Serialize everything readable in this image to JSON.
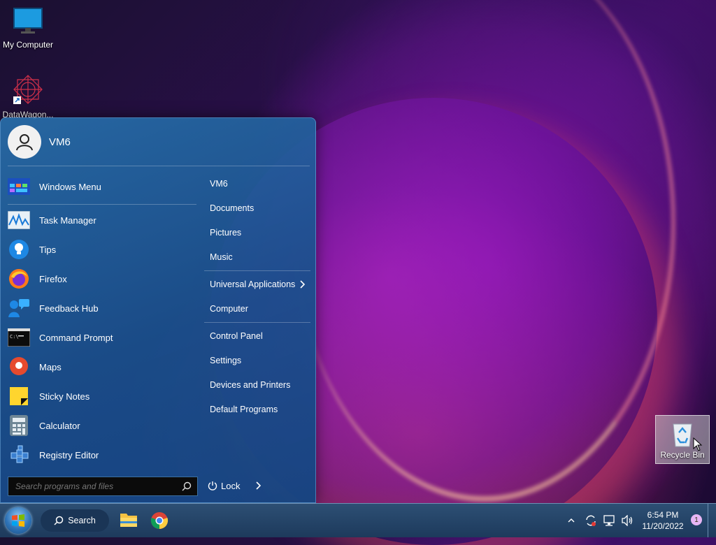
{
  "desktop": {
    "icons": [
      {
        "label": "My Computer",
        "icon": "monitor-icon"
      },
      {
        "label": "DataWagon...",
        "icon": "datawagon-shortcut-icon"
      }
    ],
    "recycle_bin": {
      "label": "Recycle Bin",
      "icon": "recycle-bin-icon"
    }
  },
  "start_menu": {
    "user": {
      "name": "VM6",
      "icon": "user-avatar-icon"
    },
    "pinned": [
      {
        "label": "Windows Menu",
        "icon": "windows-menu-icon"
      }
    ],
    "programs": [
      {
        "label": "Task Manager",
        "icon": "task-manager-icon"
      },
      {
        "label": "Tips",
        "icon": "tips-icon"
      },
      {
        "label": "Firefox",
        "icon": "firefox-icon"
      },
      {
        "label": "Feedback Hub",
        "icon": "feedback-hub-icon"
      },
      {
        "label": "Command Prompt",
        "icon": "command-prompt-icon"
      },
      {
        "label": "Maps",
        "icon": "maps-icon"
      },
      {
        "label": "Sticky Notes",
        "icon": "sticky-notes-icon"
      },
      {
        "label": "Calculator",
        "icon": "calculator-icon"
      },
      {
        "label": "Registry Editor",
        "icon": "registry-editor-icon"
      }
    ],
    "right_items": [
      {
        "label": "VM6"
      },
      {
        "label": "Documents"
      },
      {
        "label": "Pictures"
      },
      {
        "label": "Music"
      },
      {
        "label": "Universal Applications"
      },
      {
        "label": "Computer"
      },
      {
        "label": "Control Panel"
      },
      {
        "label": "Settings"
      },
      {
        "label": "Devices and Printers"
      },
      {
        "label": "Default Programs"
      }
    ],
    "search": {
      "placeholder": "Search programs and files",
      "value": ""
    },
    "lock": {
      "label": "Lock"
    }
  },
  "taskbar": {
    "search_label": "Search",
    "pinned": [
      {
        "icon": "file-explorer-icon"
      },
      {
        "icon": "chrome-icon"
      }
    ],
    "clock": {
      "time": "6:54 PM",
      "date": "11/20/2022"
    },
    "notification_count": "1"
  },
  "colors": {
    "start_menu_bg": "#2a6ea8",
    "taskbar_bg": "#254869",
    "accent": "#3a8fd6"
  }
}
